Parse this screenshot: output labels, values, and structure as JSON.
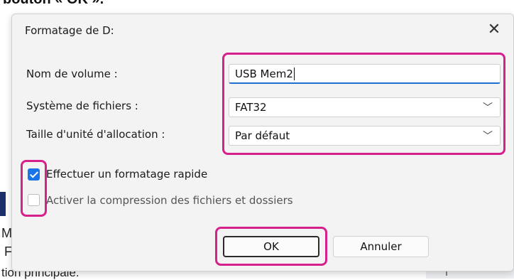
{
  "background": {
    "top_text": "bouton « OK ».",
    "left_letters": [
      "M",
      "F"
    ],
    "bottom_text": "tion principale."
  },
  "dialog": {
    "title": "Formatage de D:",
    "close_glyph": "✕",
    "volume_label": "Nom de volume :",
    "volume_value": "USB Mem2",
    "fs_label": "Système de fichiers :",
    "fs_value": "FAT32",
    "alloc_label": "Taille d'unité d'allocation :",
    "alloc_value": "Par défaut",
    "quick_format_label": "Effectuer un formatage rapide",
    "quick_format_checked": true,
    "compression_label": "Activer la compression des fichiers et dossiers",
    "compression_checked": false,
    "ok_label": "OK",
    "cancel_label": "Annuler"
  },
  "icons": {
    "close": "close-icon",
    "dropdown": "chevron-down-icon"
  },
  "colors": {
    "highlight": "#d6208b",
    "accent": "#1a73e8",
    "dialog_bg": "#f3f3f3"
  }
}
